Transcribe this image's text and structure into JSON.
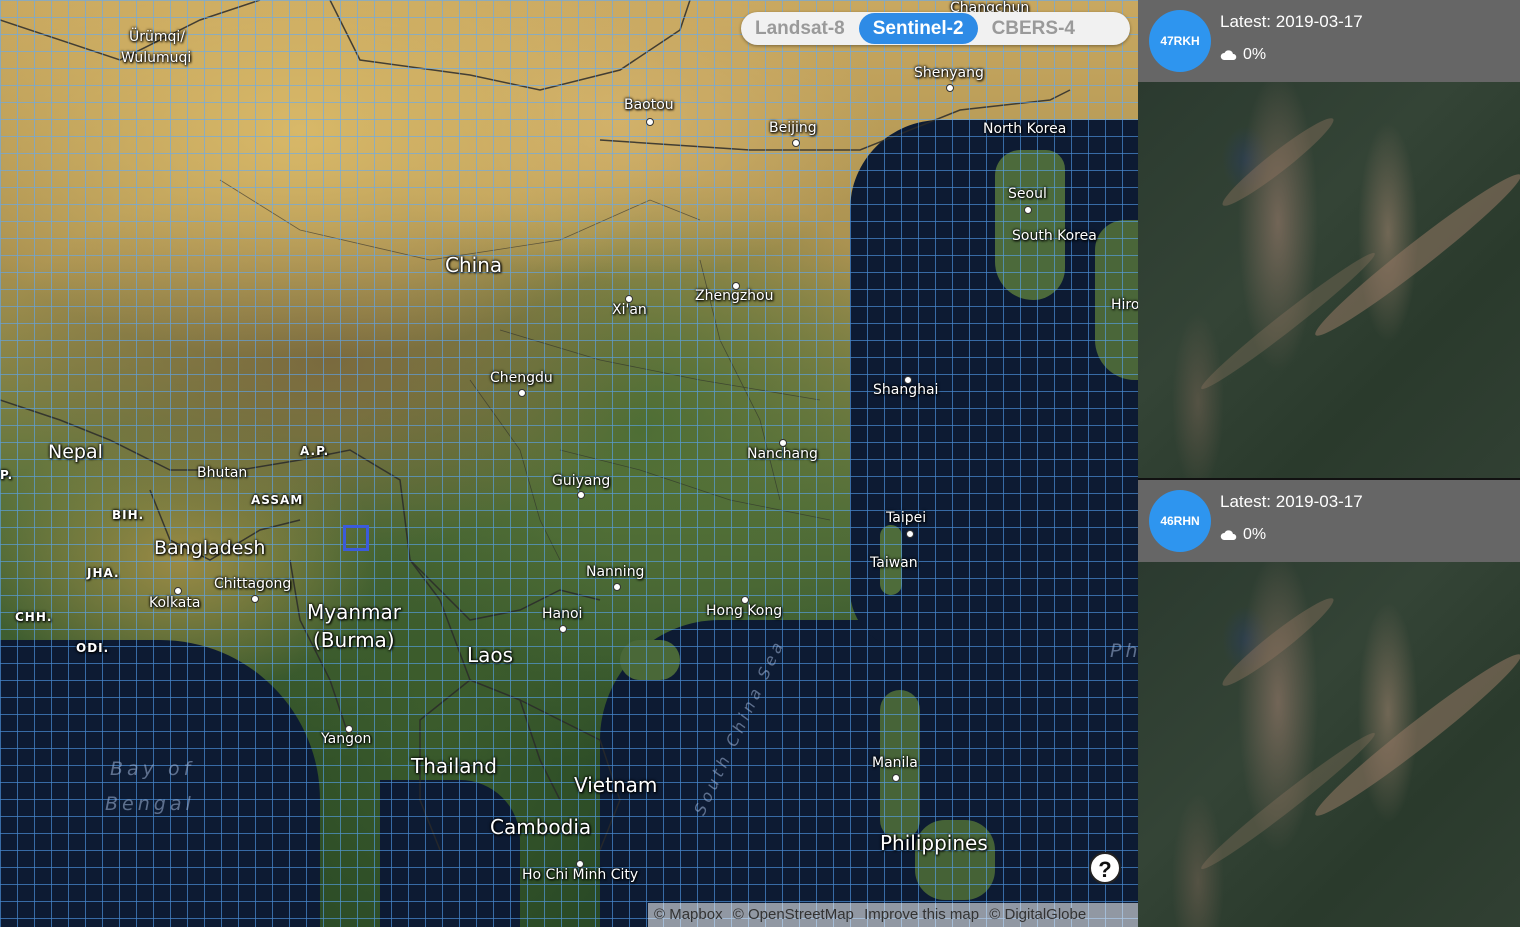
{
  "toggle": {
    "options": [
      "Landsat-8",
      "Sentinel-2",
      "CBERS-4"
    ],
    "active": "Sentinel-2"
  },
  "labels": {
    "countries": {
      "china": "China",
      "nepal": "Nepal",
      "bhutan": "Bhutan",
      "bangladesh": "Bangladesh",
      "myanmar": "Myanmar",
      "myanmar2": "(Burma)",
      "laos": "Laos",
      "thailand": "Thailand",
      "vietnam": "Vietnam",
      "cambodia": "Cambodia",
      "philippines": "Philippines",
      "north_korea": "North Korea",
      "south_korea": "South Korea",
      "taiwan": "Taiwan"
    },
    "cities": {
      "urumqi": "Ürümqi/",
      "urumqi2": "Wulumuqi",
      "baotou": "Baotou",
      "beijing": "Beijing",
      "shenyang": "Shenyang",
      "changchun": "Changchun",
      "seoul": "Seoul",
      "xian": "Xi'an",
      "zhengzhou": "Zhengzhou",
      "chengdu": "Chengdu",
      "shanghai": "Shanghai",
      "nanchang": "Nanchang",
      "guiyang": "Guiyang",
      "taipei": "Taipei",
      "nanning": "Nanning",
      "hanoi": "Hanoi",
      "hong_kong": "Hong Kong",
      "chittagong": "Chittagong",
      "kolkata": "Kolkata",
      "yangon": "Yangon",
      "manila": "Manila",
      "ho_chi_minh": "Ho Chi Minh City",
      "hiro": "Hiro"
    },
    "regions": {
      "ap": "A.P.",
      "assam": "ASSAM",
      "bih": "BIH.",
      "jha": "JHA.",
      "chh": "CHH.",
      "odi": "ODI.",
      "p": "P."
    },
    "water": {
      "bay1": "Bay of",
      "bay2": "Bengal",
      "scs": "South China Sea",
      "ph": "Ph"
    }
  },
  "help_label": "?",
  "attribution": {
    "mapbox": "© Mapbox",
    "osm": "© OpenStreetMap",
    "improve": "Improve this map",
    "dg": "© DigitalGlobe"
  },
  "scenes": [
    {
      "tile": "47RKH",
      "latest": "Latest: 2019-03-17",
      "cloud": "0%"
    },
    {
      "tile": "46RHN",
      "latest": "Latest: 2019-03-17",
      "cloud": "0%"
    }
  ]
}
